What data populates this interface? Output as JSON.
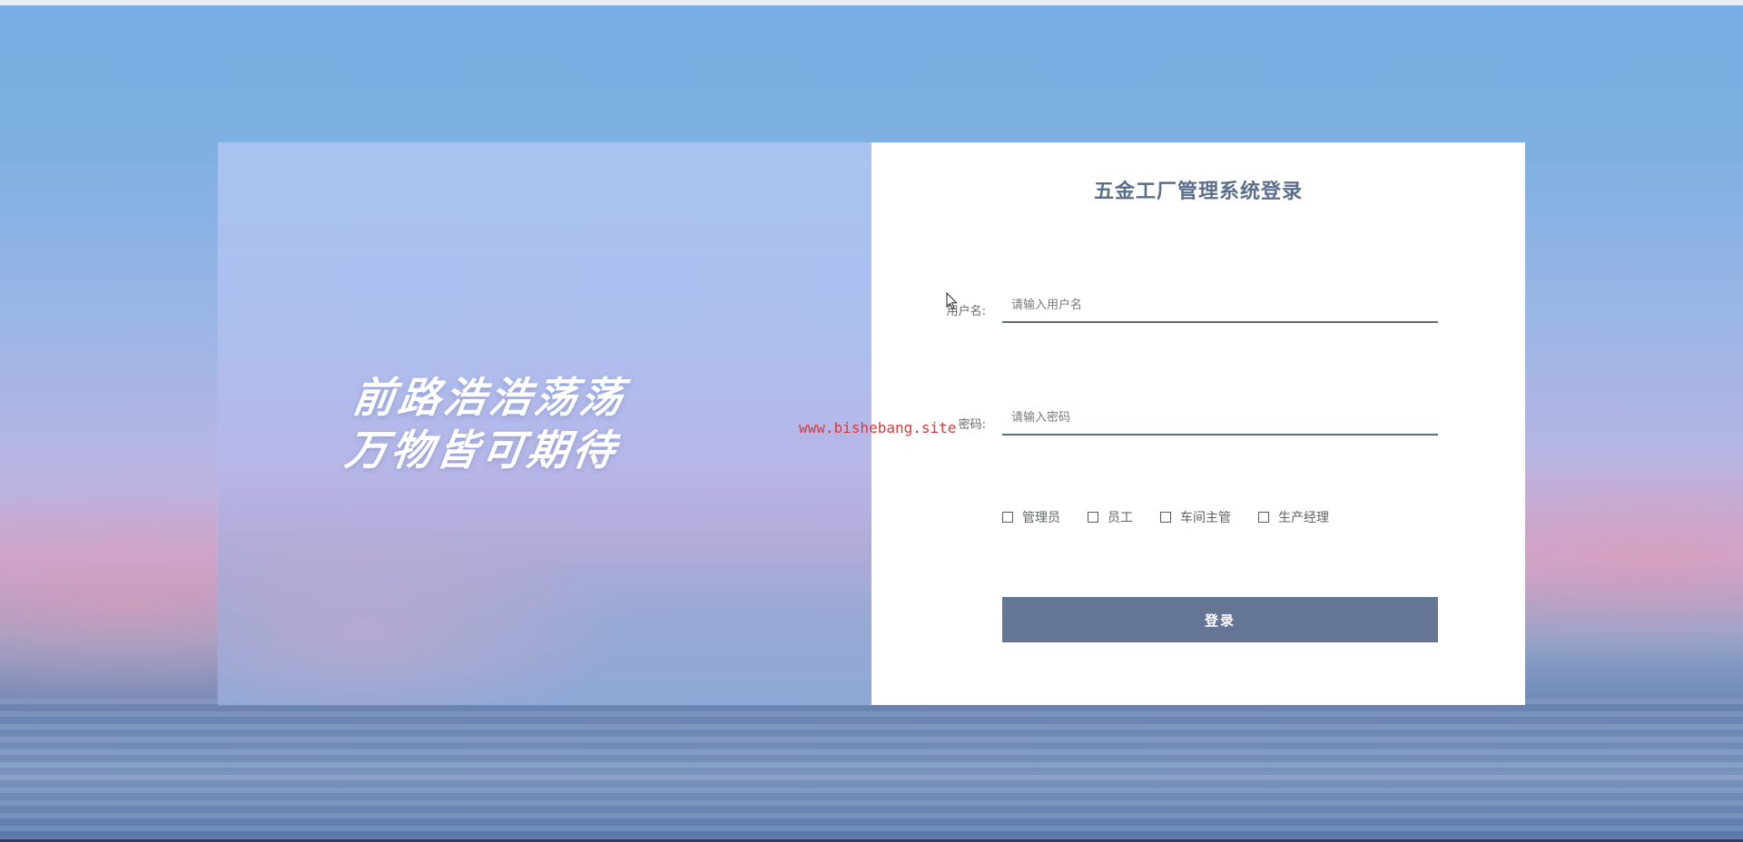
{
  "left_panel": {
    "slogan_line1": "前路浩浩荡荡",
    "slogan_line2": "万物皆可期待"
  },
  "login_form": {
    "title": "五金工厂管理系统登录",
    "username": {
      "label": "用户名:",
      "placeholder": "请输入用户名",
      "value": ""
    },
    "password": {
      "label": "密码:",
      "placeholder": "请输入密码",
      "value": ""
    },
    "roles": [
      {
        "label": "管理员",
        "checked": false
      },
      {
        "label": "员工",
        "checked": false
      },
      {
        "label": "车间主管",
        "checked": false
      },
      {
        "label": "生产经理",
        "checked": false
      }
    ],
    "submit_label": "登录"
  },
  "watermark": "www.bishebang.site",
  "icons": {
    "cursor": "mouse-pointer-icon",
    "checkbox": "checkbox-unchecked-icon"
  },
  "colors": {
    "title": "#5b6e8c",
    "button": "#647596",
    "input_underline": "#5e6b7d",
    "watermark": "#d63a3a"
  }
}
